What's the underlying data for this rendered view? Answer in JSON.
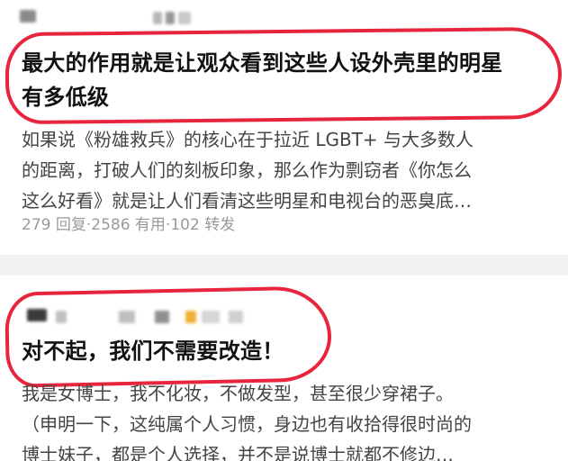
{
  "answers": [
    {
      "title_line1": "最大的作用就是让观众看到这些人设外壳里的明星",
      "title_line2": "有多低级",
      "excerpt_lines": [
        "如果说《粉雄救兵》的核心在于拉近 LGBT+ 与大多数人",
        "的距离，打破人们的刻板印象，那么作为剽窃者《你怎么",
        "这么好看》就是让人们看清这些明星和电视台的恶臭底…"
      ],
      "stats": {
        "replies": "279 回复",
        "separator": " · ",
        "useful": "2586 有用",
        "reposts": "102 转发"
      }
    },
    {
      "title_line1": "对不起，我们不需要改造！",
      "excerpt_lines": [
        "我是女博士，我不化妆，不做发型，甚至很少穿裙子。",
        "（申明一下，这纯属个人习惯，身边也有收拾得很时尚的",
        "博士妹子，都是个人选择，并不是说博士就都不修边…"
      ]
    }
  ],
  "colors": {
    "annotation_circle": "#e7263d",
    "title_text": "#111111",
    "body_text": "#444444",
    "meta_text": "#9a9a9a"
  }
}
